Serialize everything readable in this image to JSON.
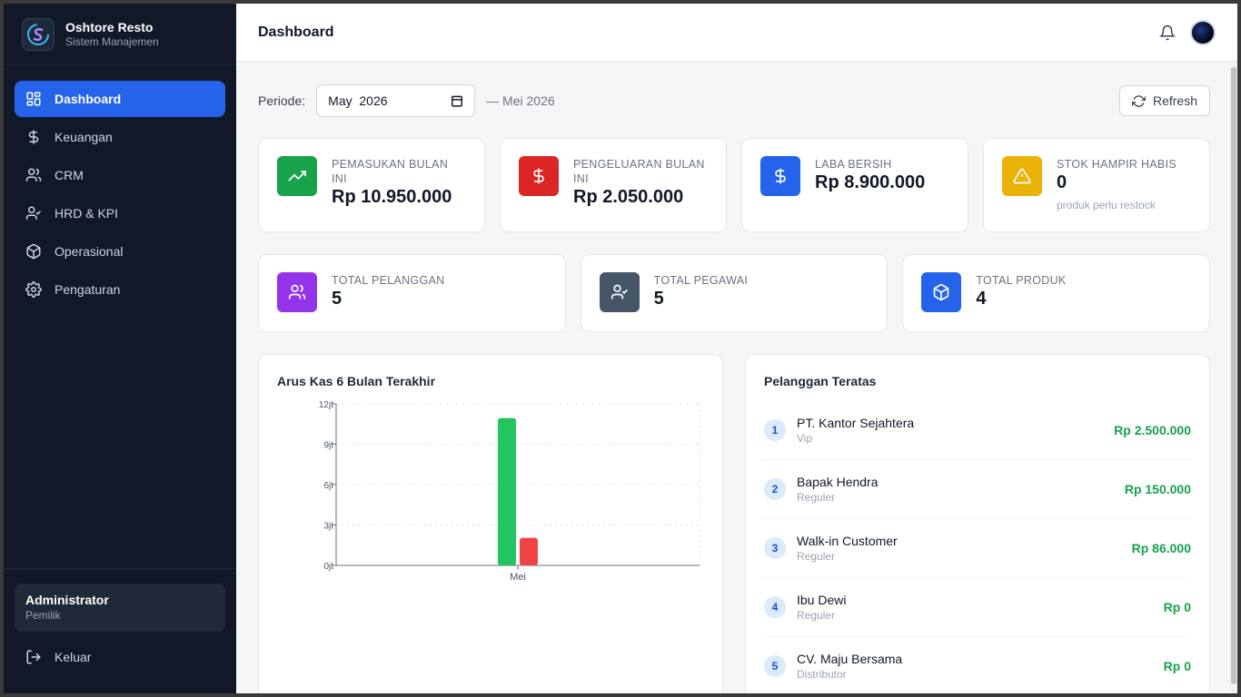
{
  "brand": {
    "name": "Oshtore Resto",
    "subtitle": "Sistem Manajemen"
  },
  "nav": [
    {
      "label": "Dashboard",
      "icon": "dashboard-icon",
      "active": true
    },
    {
      "label": "Keuangan",
      "icon": "dollar-icon"
    },
    {
      "label": "CRM",
      "icon": "users-icon"
    },
    {
      "label": "HRD & KPI",
      "icon": "user-check-icon"
    },
    {
      "label": "Operasional",
      "icon": "box-icon"
    },
    {
      "label": "Pengaturan",
      "icon": "gear-icon"
    }
  ],
  "user": {
    "name": "Administrator",
    "role": "Pemilik"
  },
  "logout_label": "Keluar",
  "header": {
    "title": "Dashboard"
  },
  "period": {
    "label": "Periode:",
    "input_value": "May  2026",
    "display": "— Mei 2026"
  },
  "refresh_label": "Refresh",
  "stats_top": [
    {
      "label": "PEMASUKAN BULAN INI",
      "value": "Rp 10.950.000",
      "color": "#16a34a",
      "icon": "trending-up-icon"
    },
    {
      "label": "PENGELUARAN BULAN INI",
      "value": "Rp 2.050.000",
      "color": "#dc2626",
      "icon": "dollar-icon"
    },
    {
      "label": "LABA BERSIH",
      "value": "Rp 8.900.000",
      "color": "#2563eb",
      "icon": "dollar-icon"
    },
    {
      "label": "STOK HAMPIR HABIS",
      "value": "0",
      "note": "produk perlu restock",
      "color": "#eab308",
      "icon": "warning-icon"
    }
  ],
  "stats_bottom": [
    {
      "label": "TOTAL PELANGGAN",
      "value": "5",
      "color": "#9333ea",
      "icon": "users-icon"
    },
    {
      "label": "TOTAL PEGAWAI",
      "value": "5",
      "color": "#475569",
      "icon": "user-check-icon"
    },
    {
      "label": "TOTAL PRODUK",
      "value": "4",
      "color": "#2563eb",
      "icon": "box-icon"
    }
  ],
  "cashflow": {
    "title": "Arus Kas 6 Bulan Terakhir"
  },
  "chart_data": {
    "type": "bar",
    "title": "Arus Kas 6 Bulan Terakhir",
    "categories": [
      "Mei"
    ],
    "series": [
      {
        "values": [
          10950000
        ],
        "color": "#22c55e"
      },
      {
        "values": [
          2050000
        ],
        "color": "#ef4444"
      }
    ],
    "ylim": [
      0,
      12000000
    ],
    "yticks": [
      0,
      3000000,
      6000000,
      9000000,
      12000000
    ],
    "ytick_labels": [
      "0jt",
      "3jt",
      "6jt",
      "9jt",
      "12jt"
    ],
    "grid": true
  },
  "top_customers": {
    "title": "Pelanggan Teratas",
    "items": [
      {
        "rank": "1",
        "name": "PT. Kantor Sejahtera",
        "type": "Vip",
        "amount": "Rp 2.500.000"
      },
      {
        "rank": "2",
        "name": "Bapak Hendra",
        "type": "Reguler",
        "amount": "Rp 150.000"
      },
      {
        "rank": "3",
        "name": "Walk-in Customer",
        "type": "Reguler",
        "amount": "Rp 86.000"
      },
      {
        "rank": "4",
        "name": "Ibu Dewi",
        "type": "Reguler",
        "amount": "Rp 0"
      },
      {
        "rank": "5",
        "name": "CV. Maju Bersama",
        "type": "Distributor",
        "amount": "Rp 0"
      }
    ]
  }
}
